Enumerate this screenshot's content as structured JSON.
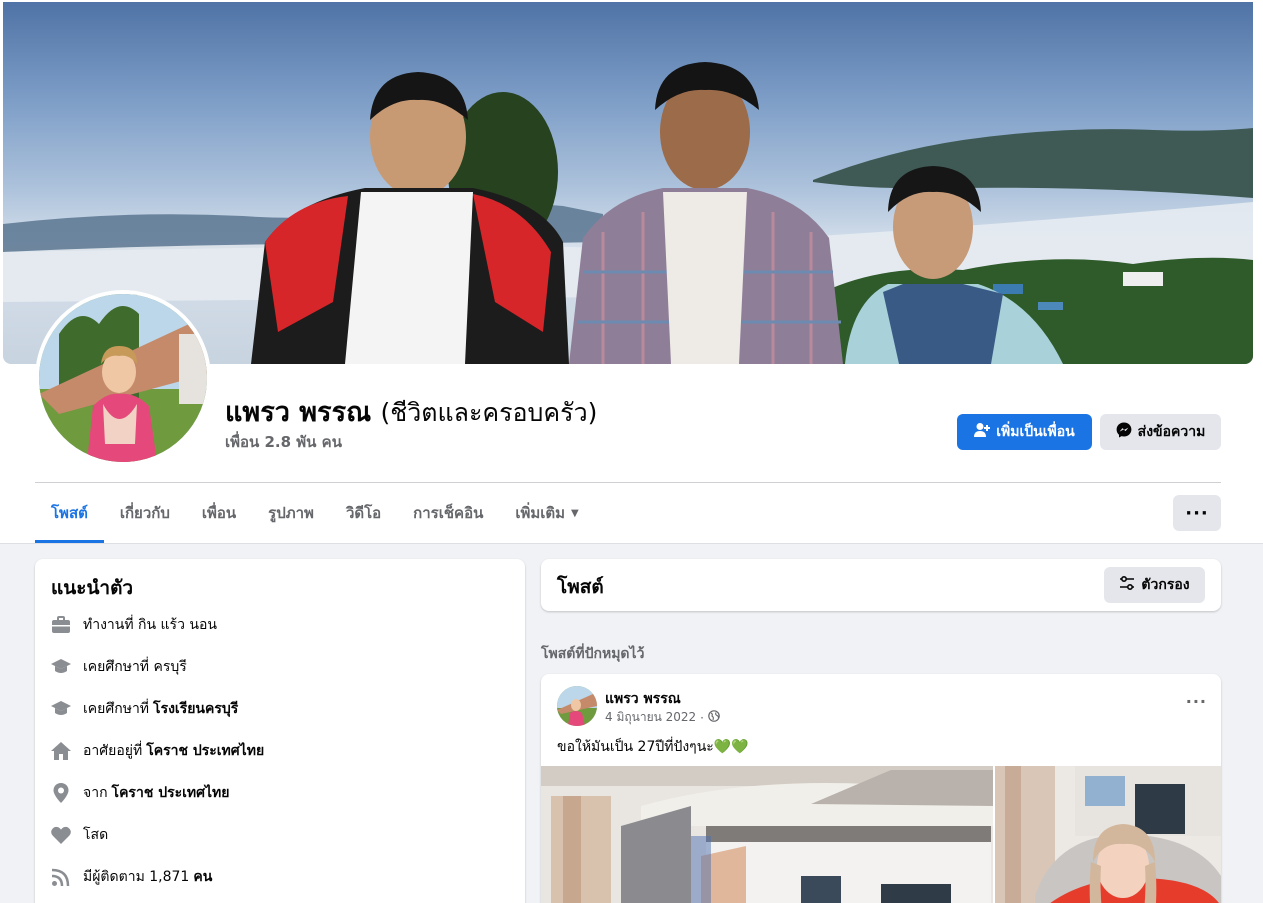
{
  "profile": {
    "name": "แพรว พรรณ",
    "alt_name": "(ชีวิตและครอบครัว)",
    "friends": "เพื่อน 2.8 พัน คน"
  },
  "actions": {
    "add_friend": "เพิ่มเป็นเพื่อน",
    "message": "ส่งข้อความ"
  },
  "tabs": [
    {
      "label": "โพสต์",
      "active": true
    },
    {
      "label": "เกี่ยวกับ"
    },
    {
      "label": "เพื่อน"
    },
    {
      "label": "รูปภาพ"
    },
    {
      "label": "วิดีโอ"
    },
    {
      "label": "การเช็คอิน"
    },
    {
      "label": "เพิ่มเติม"
    }
  ],
  "intro": {
    "title": "แนะนำตัว",
    "items": [
      {
        "icon": "briefcase-icon",
        "text": "ทำงานที่ กิน แร้ว นอน",
        "bold": ""
      },
      {
        "icon": "graduation-cap-icon",
        "text": "เคยศึกษาที่ ครบุรี",
        "bold": ""
      },
      {
        "icon": "graduation-cap-icon",
        "text": "เคยศึกษาที่",
        "bold": "โรงเรียนครบุรี"
      },
      {
        "icon": "home-icon",
        "text": "อาศัยอยู่ที่",
        "bold": "โคราช ประเทศไทย"
      },
      {
        "icon": "location-pin-icon",
        "text": "จาก",
        "bold": "โคราช ประเทศไทย"
      },
      {
        "icon": "heart-icon",
        "text": "โสด",
        "bold": ""
      },
      {
        "icon": "rss-icon",
        "text": "มีผู้ติดตาม 1,871",
        "bold": "คน"
      }
    ]
  },
  "posts": {
    "title": "โพสต์",
    "filter": "ตัวกรอง",
    "pinned_label": "โพสต์ที่ปักหมุดไว้",
    "pinned_post": {
      "author": "แพรว พรรณ",
      "date": "4 มิถุนายน 2022",
      "separator": "·",
      "text": "ขอให้มันเป็น 27ปีที่ปังๆนะ",
      "emoji": "💚💚"
    }
  },
  "colors": {
    "accent": "#1b74e4",
    "secondary_text": "#65676b",
    "button_gray": "#e4e6eb",
    "page_bg": "#f0f2f5"
  }
}
